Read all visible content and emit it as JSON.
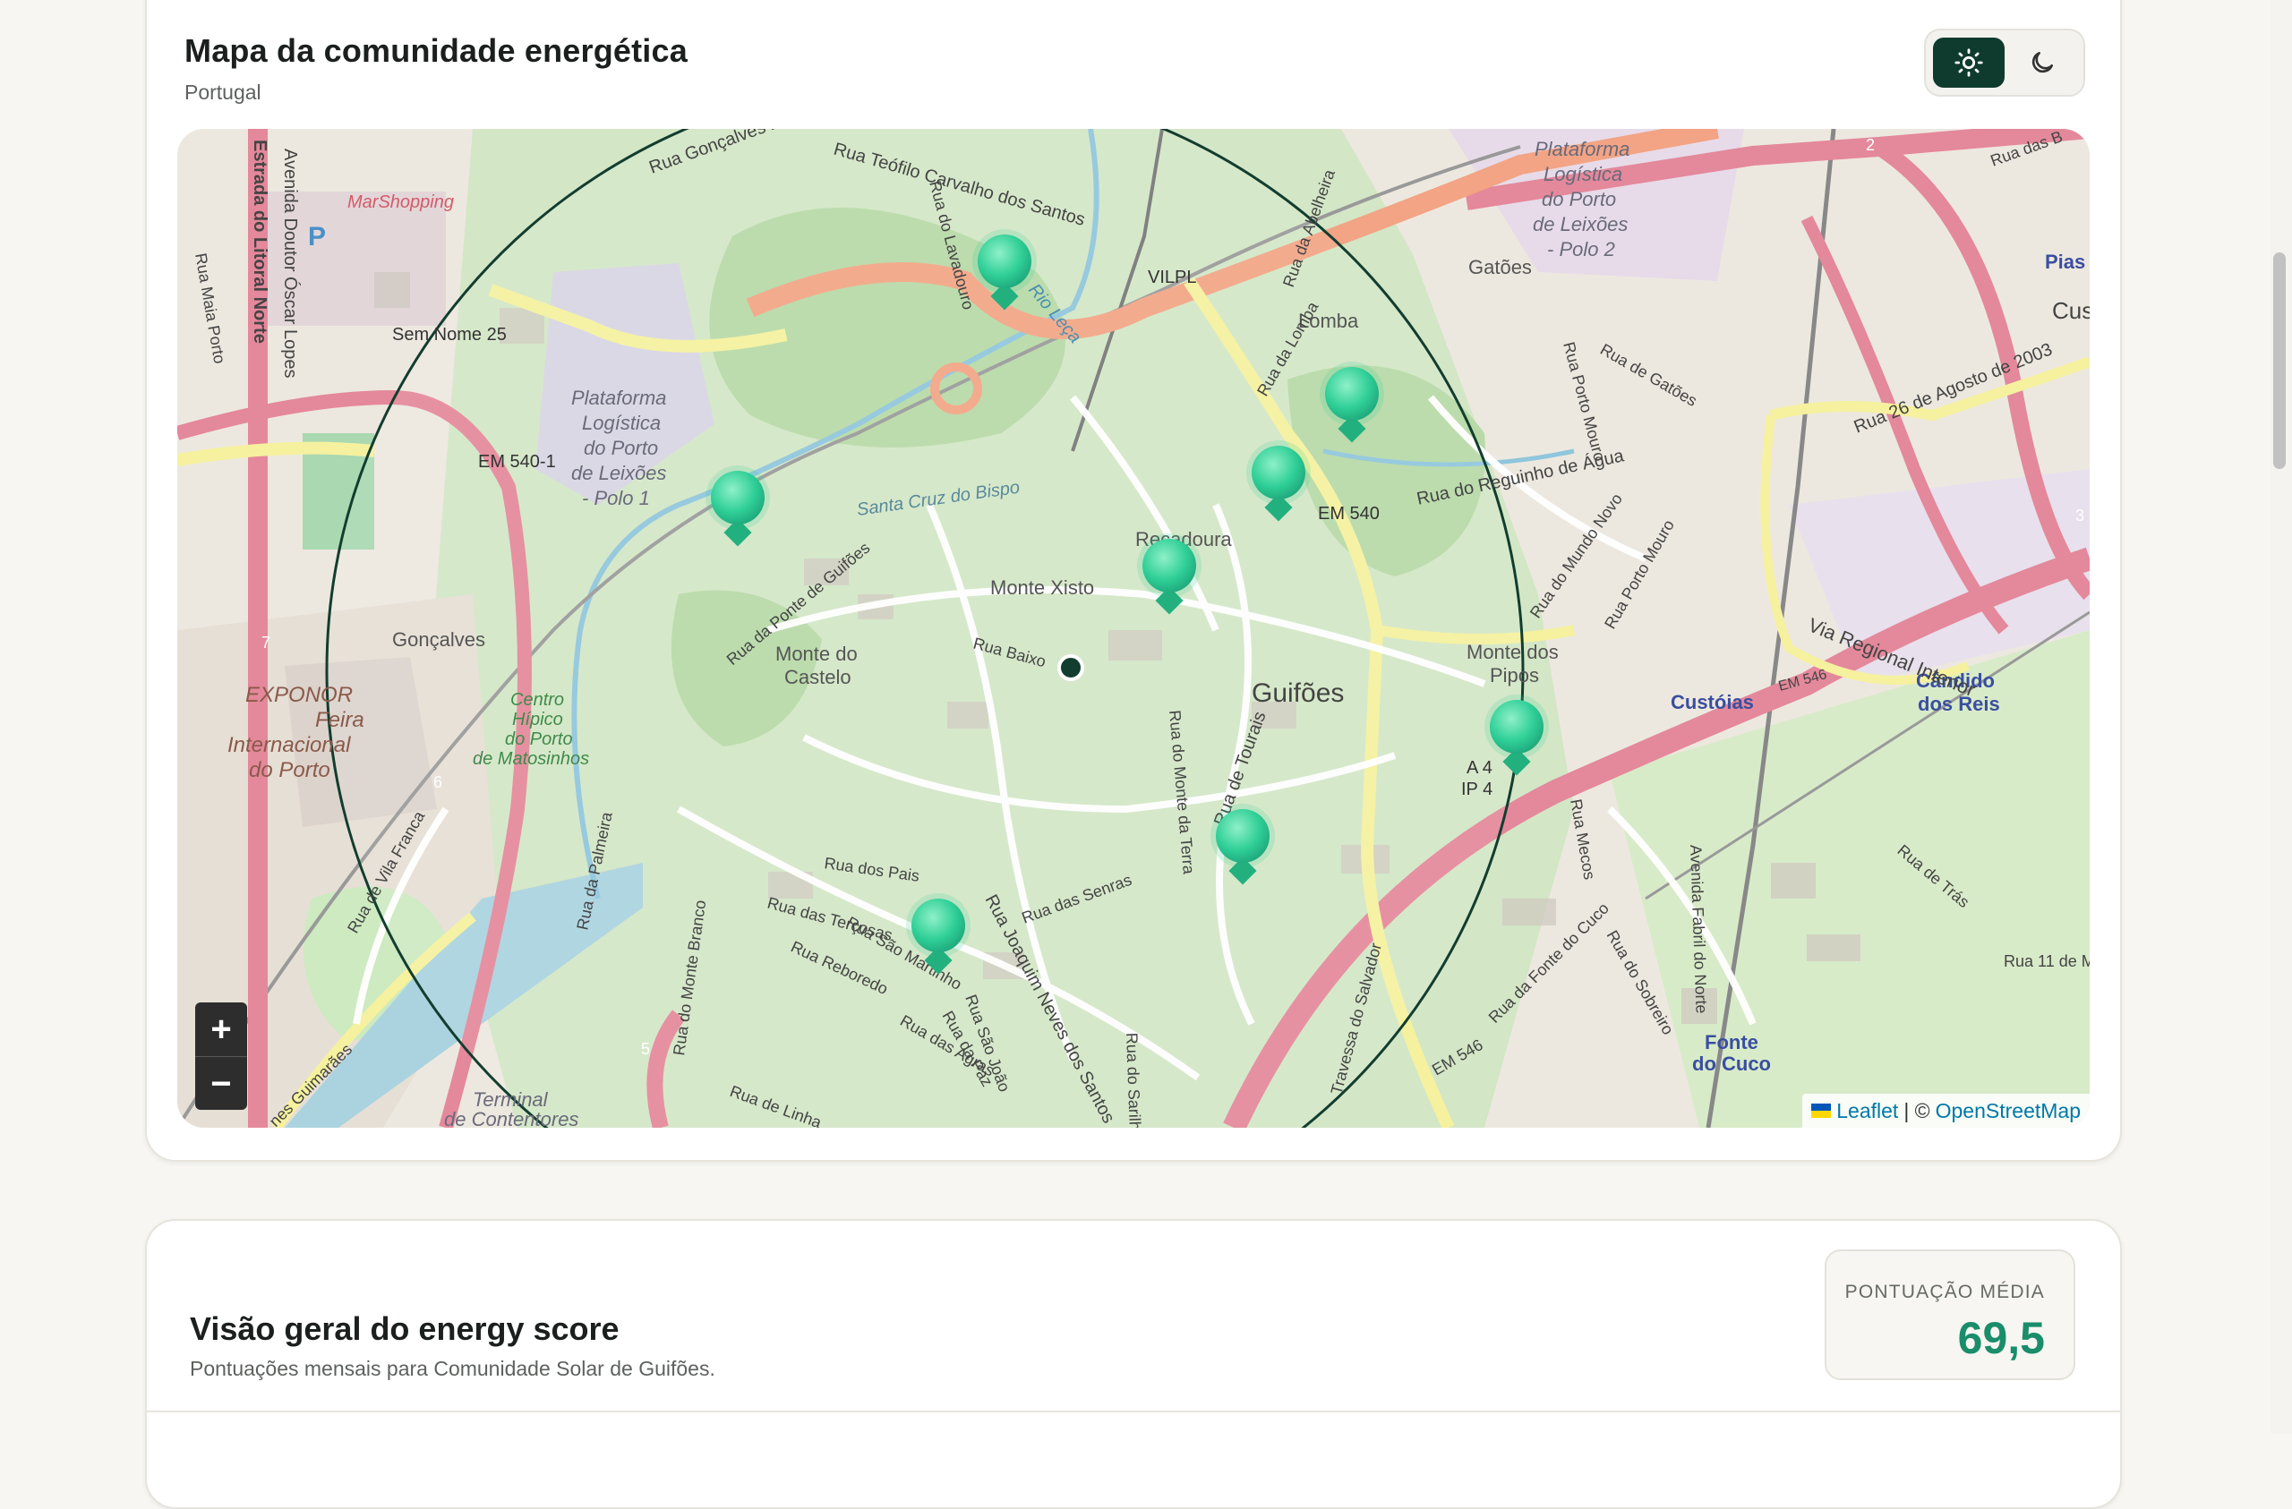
{
  "map_section": {
    "title": "Mapa da comunidade energética",
    "subtitle": "Portugal",
    "theme_toggle": {
      "options": [
        "light",
        "dark"
      ],
      "selected": "light"
    },
    "icons": {
      "light": "sun-icon",
      "dark": "moon-icon"
    },
    "map": {
      "labels": {
        "gatoes": "Gatões",
        "lomba": "Lomba",
        "guifoes": "Guifões",
        "monte_xisto": "Monte Xisto",
        "monte_castelo_1": "Monte do",
        "monte_castelo_2": "Castelo",
        "monte_pipos_1": "Monte dos",
        "monte_pipos_2": "Pipos",
        "recadoura": "Recadoura",
        "santa_cruz": "Santa Cruz do Bispo",
        "marshopping": "MarShopping",
        "sem_nome": "Sem Nome 25",
        "em540_1": "EM 540-1",
        "em540": "EM 540",
        "vilpl": "VILPL",
        "a4": "A 4",
        "ip4": "IP 4",
        "custoias": "Custóias",
        "candido_1": "Cândido",
        "candido_2": "dos Reis",
        "fonte_cuco_1": "Fonte",
        "fonte_cuco_2": "do Cuco",
        "pias": "Pias",
        "cus": "Cus",
        "goncalves": "Gonçalves",
        "exponor_1": "EXPONOR",
        "exponor_2": "Feira",
        "exponor_3": "Internacional",
        "exponor_4": "do Porto",
        "centro_hipico_1": "Centro",
        "centro_hipico_2": "Hípico",
        "centro_hipico_3": "do Porto",
        "centro_hipico_4": "de Matosinhos",
        "plataforma_a_1": "Plataforma",
        "plataforma_a_2": "Logística",
        "plataforma_a_3": "do Porto",
        "plataforma_a_4": "de Leixões",
        "plataforma_a_5": "- Polo 1",
        "plataforma_b_1": "Plataforma",
        "plataforma_b_2": "Logística",
        "plataforma_b_3": "do Porto",
        "plataforma_b_4": "de Leixões",
        "plataforma_b_5": "- Polo 2",
        "terminal_1": "Terminal",
        "terminal_2": "de Contentores",
        "via_regional": "Via Regional Interior",
        "rua_26_agosto": "Rua 26 de Agosto de 2003",
        "rua_teofilo": "Rua Teófilo Carvalho dos Santos",
        "rua_goncalves_zarco": "Rua Gonçalves Zarco",
        "rua_reguinho": "Rua do Reguinho de Água",
        "avenida_oscar": "Avenida Doutor Óscar Lopes",
        "estrada_litoral": "Estrada do Litoral Norte",
        "rio_leca": "Rio Leça",
        "rua_joaquim": "Rua Joaquim Neves dos Santos",
        "rua_tourais": "Rua de Tourais",
        "rua_gatoes": "Rua de Gatões",
        "rua_porto_mouro": "Rua Porto Mouro",
        "rua_ponte_guifoes": "Rua da Ponte de Guifões",
        "rua_baixo": "Rua Baixo",
        "rua_pais": "Rua dos Pais",
        "rua_tercosas": "Rua das Terçosas",
        "rua_senras": "Rua das Senras",
        "rua_reboredo": "Rua Reboredo",
        "rua_sao_martinho": "Rua São Martinho",
        "rua_monte_branco": "Rua do Monte Branco",
        "rua_palmeira": "Rua da Palmeira",
        "rua_mundo_novo": "Rua do Mundo Novo",
        "rua_porto_mouro_2": "Rua Porto Mouro",
        "rua_fonte_cuco": "Rua da Fonte do Cuco",
        "rua_sobreiro": "Rua do Sobreiro",
        "travessa_salvador": "Travessa do Salvador",
        "rua_tras": "Rua de Trás",
        "rua_11": "Rua 11 de M",
        "rua_abelheira": "Rua da Abelheira",
        "rua_lomba": "Rua da Lomba",
        "rua_mecos": "Rua Mecos",
        "rua_lavadouro": "Rua do Lavadouro",
        "rua_maia_porto": "Rua Maia Porto",
        "rua_vila_franca": "Rua de Vila Franca",
        "rua_sao_joao": "Rua São João",
        "rua_paz": "Rua da Paz",
        "rua_agras": "Rua das Agras",
        "rua_linha": "Rua de Linha",
        "rua_sarilho": "Rua do Sarilho",
        "rua_monte_terra": "Rua do Monte da Terra",
        "av_fabril": "Avenida Fabril do Norte",
        "rua_guimaraes": "nes Guimarães",
        "rua_dasb": "Rua das B",
        "em546": "EM 546",
        "em546_b": "EM 546",
        "road_2": "2",
        "road_3": "3",
        "road_5": "5",
        "road_6": "6",
        "road_7": "7"
      },
      "community_markers": 9,
      "zoom_in_label": "+",
      "zoom_out_label": "−",
      "attribution": {
        "leaflet": "Leaflet",
        "separator": "| ©",
        "osm": "OpenStreetMap"
      }
    }
  },
  "score_section": {
    "title": "Visão geral do energy score",
    "subtitle": "Pontuações mensais para Comunidade Solar de Guifões.",
    "average_label": "PONTUAÇÃO MÉDIA",
    "average_value": "69,5"
  },
  "colors": {
    "accent_dark": "#0f3b2e",
    "score_green": "#1a8d6a",
    "marker_green": "#2fcf97"
  }
}
